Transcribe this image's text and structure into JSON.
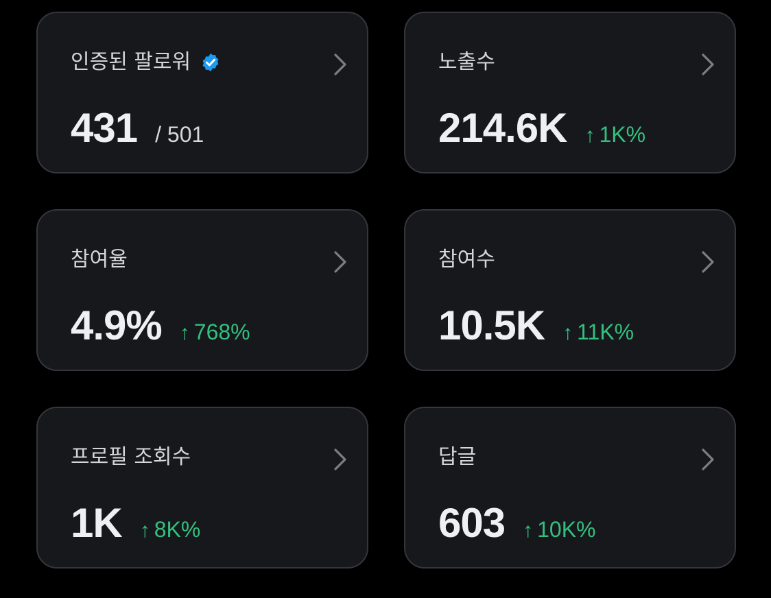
{
  "cards": [
    {
      "label": "인증된 팔로워",
      "verified_icon": "verified-badge-icon",
      "value": "431",
      "total": "/ 501",
      "chevron_icon": "chevron-right-icon"
    },
    {
      "label": "노출수",
      "value": "214.6K",
      "change_arrow": "↑",
      "change": "1K%",
      "chevron_icon": "chevron-right-icon"
    },
    {
      "label": "참여율",
      "value": "4.9%",
      "change_arrow": "↑",
      "change": "768%",
      "chevron_icon": "chevron-right-icon"
    },
    {
      "label": "참여수",
      "value": "10.5K",
      "change_arrow": "↑",
      "change": "11K%",
      "chevron_icon": "chevron-right-icon"
    },
    {
      "label": "프로필 조회수",
      "value": "1K",
      "change_arrow": "↑",
      "change": "8K%",
      "chevron_icon": "chevron-right-icon"
    },
    {
      "label": "답글",
      "value": "603",
      "change_arrow": "↑",
      "change": "10K%",
      "chevron_icon": "chevron-right-icon"
    }
  ],
  "colors": {
    "background": "#000000",
    "card": "#17181c",
    "card_border": "#34363c",
    "positive_change": "#33c07f",
    "verified_blue": "#1d9bf0"
  }
}
